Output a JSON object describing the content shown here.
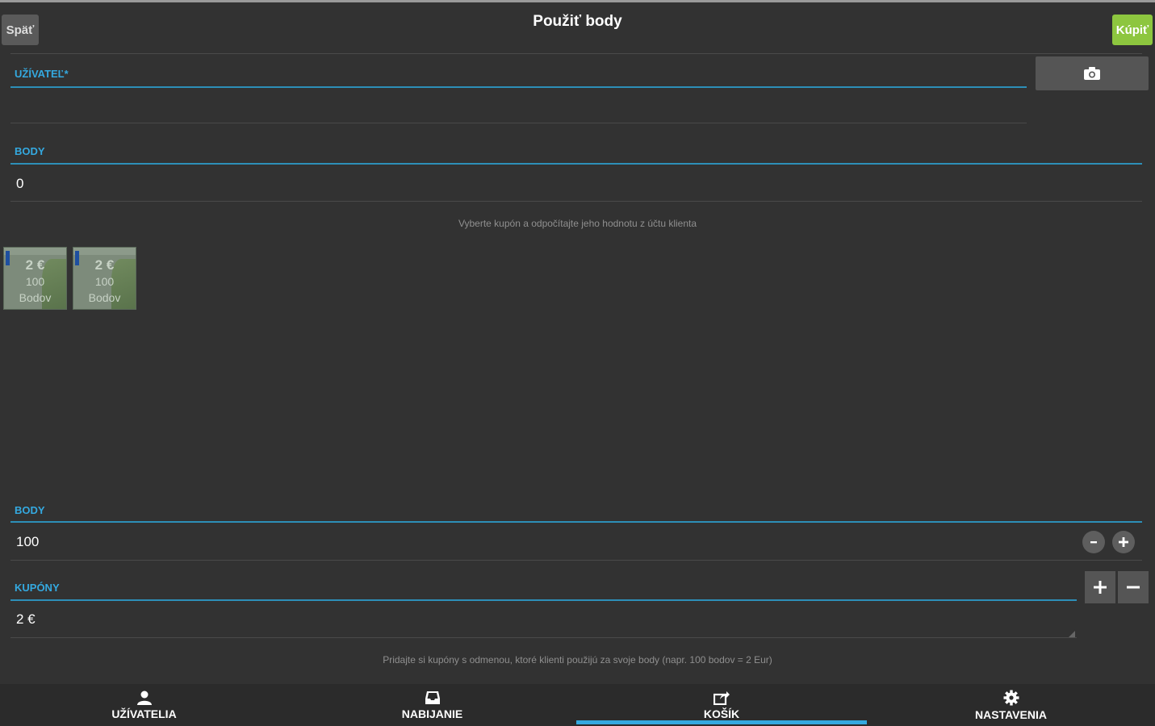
{
  "header": {
    "back_label": "Späť",
    "title": "Použiť body",
    "buy_label": "Kúpiť"
  },
  "user_field": {
    "label": "UŽÍVATEĽ*",
    "value": "",
    "camera_icon": "camera-icon"
  },
  "points_field": {
    "label": "BODY",
    "value": "0"
  },
  "coupon_hint": "Vyberte kupón a odpočítajte jeho hodnotu z účtu klienta",
  "coupons": [
    {
      "amount": "2 €",
      "points": "100",
      "unit": "Bodov"
    },
    {
      "amount": "2 €",
      "points": "100",
      "unit": "Bodov"
    }
  ],
  "points_stepper": {
    "label": "BODY",
    "value": "100",
    "minus_icon": "minus-icon",
    "plus_icon": "plus-icon"
  },
  "coupons_field": {
    "label": "KUPÓNY",
    "value": "2 €",
    "add_icon": "plus-icon",
    "remove_icon": "minus-icon"
  },
  "add_hint": "Pridajte si kupóny s odmenou, ktoré klienti použijú za svoje body (napr. 100 bodov = 2 Eur)",
  "tabs": [
    {
      "label": "UŽÍVATELIA",
      "icon": "user-icon"
    },
    {
      "label": "NABIJANIE",
      "icon": "inbox-icon"
    },
    {
      "label": "KOŠÍK",
      "icon": "cart-share-icon",
      "active": true
    },
    {
      "label": "NASTAVENIA",
      "icon": "gear-icon"
    }
  ],
  "colors": {
    "background": "#323232",
    "accent_blue": "#34a9e0",
    "buy_green": "#8dc63f"
  }
}
